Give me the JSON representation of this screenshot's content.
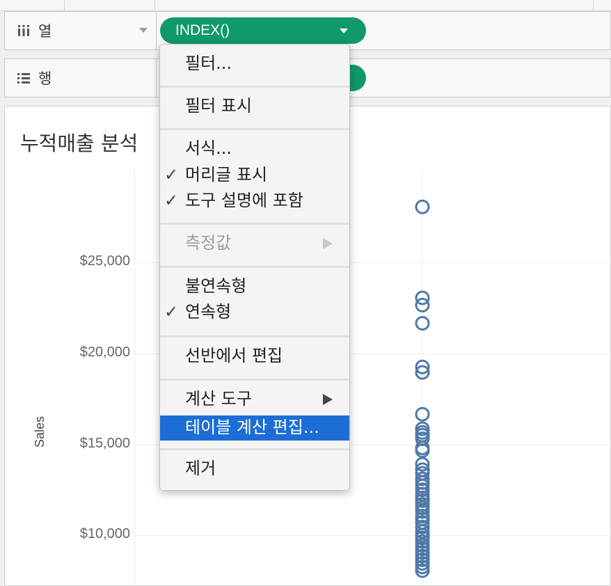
{
  "shelves": {
    "columns": {
      "label": "열",
      "icon": "columns-icon",
      "pill_label": "INDEX()"
    },
    "rows": {
      "label": "행",
      "icon": "rows-icon"
    }
  },
  "viz": {
    "title": "누적매출 분석",
    "axis_title": "Sales",
    "y_ticks": [
      "$25,000",
      "$20,000",
      "$15,000",
      "$10,000"
    ]
  },
  "context_menu": {
    "items": [
      {
        "label": "필터...",
        "checked": false,
        "disabled": false,
        "submenu": false
      },
      {
        "label": "필터 표시",
        "checked": false,
        "disabled": false,
        "submenu": false
      },
      {
        "label": "서식...",
        "checked": false,
        "disabled": false,
        "submenu": false
      },
      {
        "label": "머리글 표시",
        "checked": true,
        "disabled": false,
        "submenu": false
      },
      {
        "label": "도구 설명에 포함",
        "checked": true,
        "disabled": false,
        "submenu": false
      },
      {
        "label": "측정값",
        "checked": false,
        "disabled": true,
        "submenu": true
      },
      {
        "label": "불연속형",
        "checked": false,
        "disabled": false,
        "submenu": false
      },
      {
        "label": "연속형",
        "checked": true,
        "disabled": false,
        "submenu": false
      },
      {
        "label": "선반에서 편집",
        "checked": false,
        "disabled": false,
        "submenu": false
      },
      {
        "label": "계산 도구",
        "checked": false,
        "disabled": false,
        "submenu": true
      },
      {
        "label": "테이블 계산 편집...",
        "checked": false,
        "disabled": false,
        "submenu": false,
        "highlighted": true
      },
      {
        "label": "제거",
        "checked": false,
        "disabled": false,
        "submenu": false
      }
    ],
    "check_glyph": "✓"
  },
  "chart_data": {
    "type": "scatter",
    "title": "누적매출 분석",
    "ylabel": "Sales",
    "y_ticks": [
      10000,
      15000,
      20000,
      25000
    ],
    "series_color": "#4e79a7",
    "points_y": [
      28050,
      23050,
      22650,
      21650,
      19250,
      18950,
      16650,
      15850,
      15650,
      15500,
      15300,
      14800,
      14650,
      13900,
      13600,
      13400,
      13100,
      12900,
      12700,
      12500,
      12250,
      12050,
      11900,
      11700,
      11500,
      11300,
      11050,
      10900,
      10700,
      10450,
      10200,
      10000,
      9850,
      9650,
      9450,
      9250,
      9050,
      8850,
      8650,
      8450,
      8250,
      8050
    ]
  }
}
